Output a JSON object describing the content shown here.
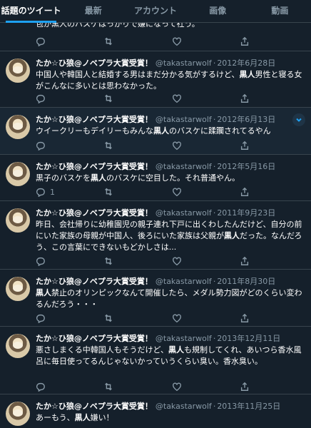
{
  "tabs": [
    {
      "label": "話題のツイート",
      "active": true
    },
    {
      "label": "最新",
      "active": false
    },
    {
      "label": "アカウント",
      "active": false
    },
    {
      "label": "画像",
      "active": false
    },
    {
      "label": "動画",
      "active": false
    }
  ],
  "partial_tweet": {
    "text": "包か黒人のバスケはっかりで嫌になって社う。"
  },
  "tweets": [
    {
      "user": "たか☆ひ狼@ノベプラ大賞受賞！",
      "handle": "@takastarwolf",
      "sep": "·",
      "date": "2012年6月28日",
      "text": [
        "中国人や韓国人と結婚する男はまだ分かる気がするけど、",
        "黒人",
        "男性と寝る女がこんなに多いとは思わなかった。"
      ],
      "reply_count": "",
      "highlighted": false
    },
    {
      "user": "たか☆ひ狼@ノベプラ大賞受賞！",
      "handle": "@takastarwolf",
      "sep": "·",
      "date": "2012年6月13日",
      "text": [
        "ウイークリーもデイリーもみんな",
        "黒人",
        "のバスケに蹂躙されてるやん"
      ],
      "reply_count": "",
      "highlighted": true
    },
    {
      "user": "たか☆ひ狼@ノベプラ大賞受賞！",
      "handle": "@takastarwolf",
      "sep": "·",
      "date": "2012年5月16日",
      "text": [
        "黒子のバスケを",
        "黒人",
        "のバスケに空目した。それ普通やん。"
      ],
      "reply_count": "1",
      "highlighted": false
    },
    {
      "user": "たか☆ひ狼@ノベプラ大賞受賞！",
      "handle": "@takastarwolf",
      "sep": "·",
      "date": "2011年9月23日",
      "text": [
        "昨日、会社帰りに幼稚園児の親子連れ下戸に出くわしたんだけど、自分の前にいた家族の母親が中国人、後ろにいた家族は父親が",
        "黒人",
        "だった。なんだろう、この言葉にできないもどかしさは..."
      ],
      "reply_count": "",
      "highlighted": false
    },
    {
      "user": "たか☆ひ狼@ノベプラ大賞受賞！",
      "handle": "@takastarwolf",
      "sep": "·",
      "date": "2011年8月30日",
      "text": [
        "",
        "黒人",
        "禁止のオリンピックなんて開催したら、メダル勢力図がどのくらい変わるんだろう・・・"
      ],
      "reply_count": "",
      "highlighted": false
    },
    {
      "user": "たか☆ひ狼@ノベプラ大賞受賞！",
      "handle": "@takastarwolf",
      "sep": "·",
      "date": "2013年12月11日",
      "text": [
        "悪さしまくる中韓国人もそうだけど、",
        "黒人",
        "も規制してくれ、あいつら香水風呂に毎日使ってるんじゃないかっていうくらい臭い。香水臭い。"
      ],
      "reply_count": "",
      "highlighted": false
    },
    {
      "user": "たか☆ひ狼@ノベプラ大賞受賞！",
      "handle": "@takastarwolf",
      "sep": "·",
      "date": "2013年11月25日",
      "text": [
        "あーもう、",
        "黒人",
        "嫌い！"
      ],
      "reply_count": "",
      "highlighted": false
    }
  ],
  "icons": [
    "reply-icon",
    "retweet-icon",
    "like-icon",
    "share-icon",
    "chevron-down-icon",
    "avatar"
  ],
  "colors": {
    "background": "#15202b",
    "highlight": "#192734",
    "accent": "#1da1f2",
    "muted": "#8899a6",
    "border": "#38444d"
  }
}
